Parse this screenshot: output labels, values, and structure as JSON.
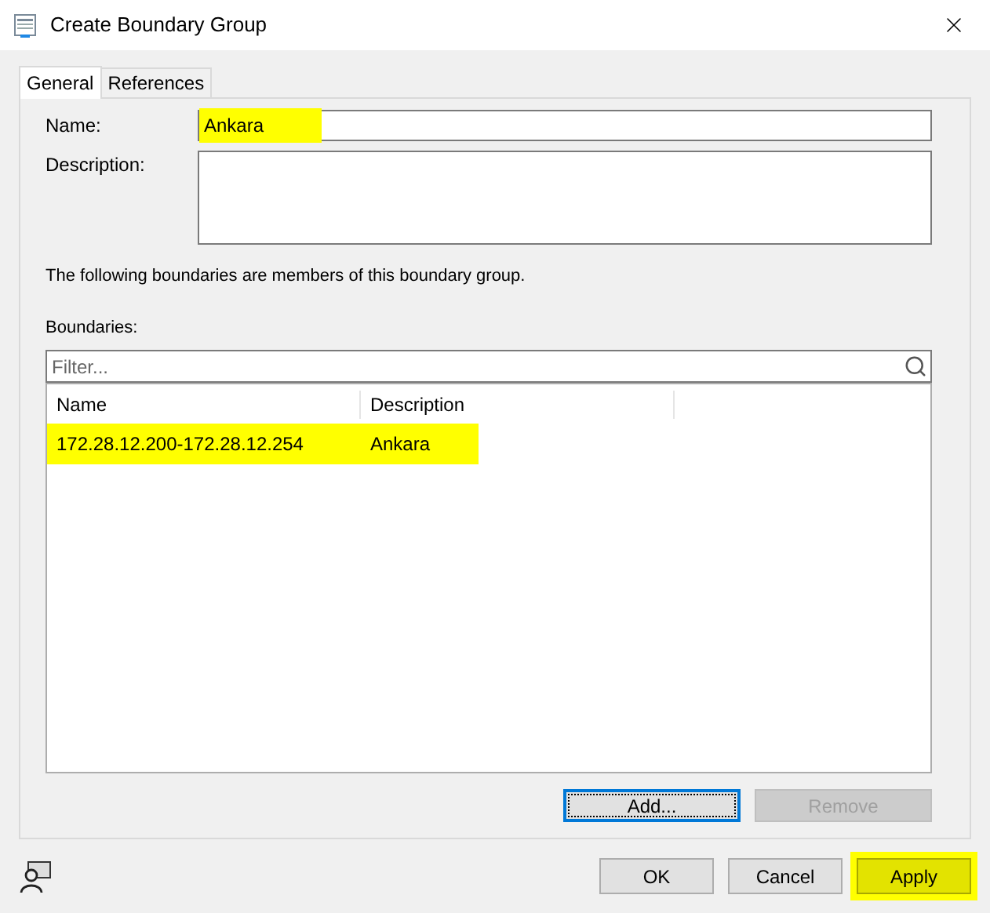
{
  "window": {
    "title": "Create Boundary Group"
  },
  "tabs": [
    {
      "label": "General",
      "selected": true
    },
    {
      "label": "References",
      "selected": false
    }
  ],
  "name_field": {
    "label": "Name:",
    "value": "Ankara",
    "highlighted": true
  },
  "description_field": {
    "label": "Description:"
  },
  "info_text": "The following boundaries are members of this boundary group.",
  "boundaries": {
    "label": "Boundaries:",
    "filter": {
      "placeholder": "Filter..."
    },
    "columns": [
      "Name",
      "Description"
    ],
    "rows": [
      {
        "name": "172.28.12.200-172.28.12.254",
        "description": "Ankara",
        "highlighted": true
      }
    ],
    "buttons": [
      {
        "label": "Add...",
        "disabled": false,
        "focused": true
      },
      {
        "label": "Remove",
        "disabled": true,
        "focused": false
      }
    ]
  },
  "footer_buttons": [
    {
      "label": "OK",
      "highlighted": false
    },
    {
      "label": "Cancel",
      "highlighted": false
    },
    {
      "label": "Apply",
      "highlighted": true
    }
  ]
}
